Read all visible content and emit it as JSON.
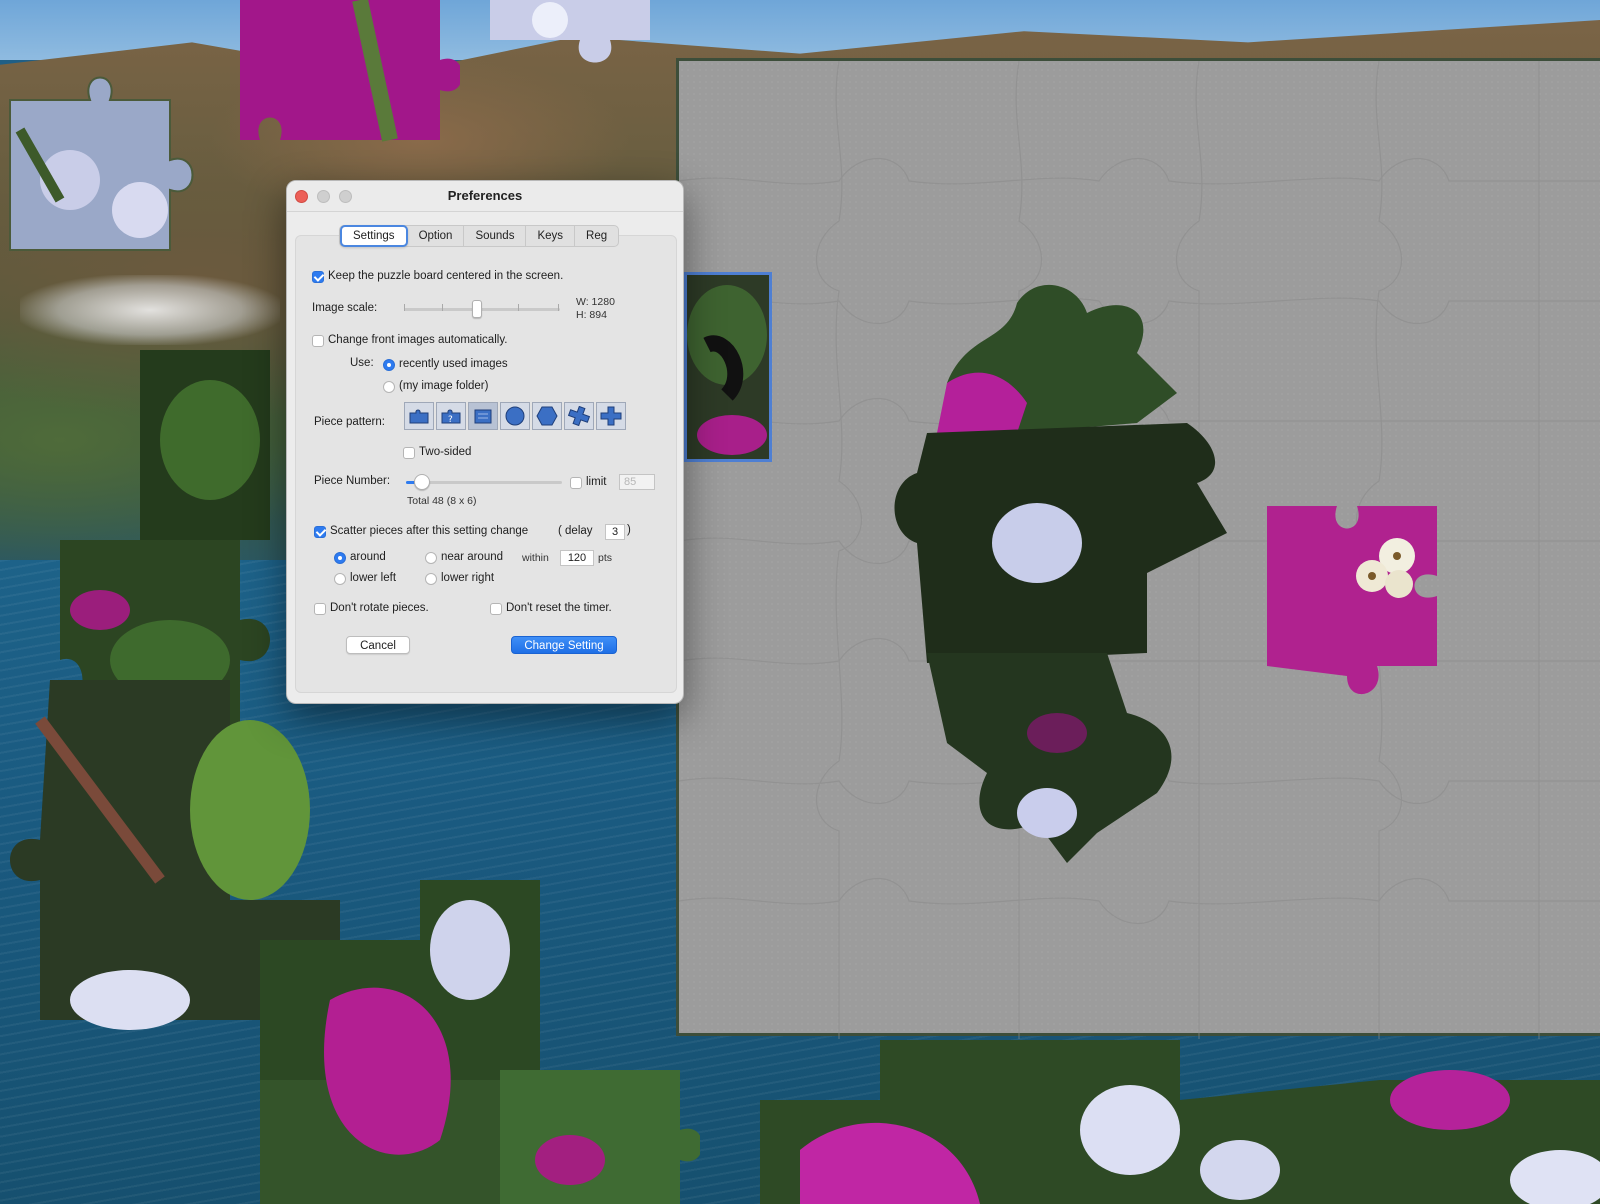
{
  "window": {
    "title": "Preferences"
  },
  "tabs": [
    {
      "label": "Settings",
      "active": true
    },
    {
      "label": "Option",
      "active": false
    },
    {
      "label": "Sounds",
      "active": false
    },
    {
      "label": "Keys",
      "active": false
    },
    {
      "label": "Reg",
      "active": false
    }
  ],
  "settings": {
    "keep_centered": {
      "label": "Keep the puzzle board centered in the screen.",
      "checked": true
    },
    "image_scale": {
      "label": "Image scale:",
      "width": "W: 1280",
      "height": "H: 894"
    },
    "change_front": {
      "label": "Change front images automatically.",
      "checked": false
    },
    "use": {
      "label": "Use:",
      "options": [
        {
          "label": "recently used images",
          "selected": true
        },
        {
          "label": "(my image folder)",
          "selected": false
        }
      ]
    },
    "piece_pattern": {
      "label": "Piece pattern:",
      "icons": [
        "classic-piece-icon",
        "question-piece-icon",
        "square-piece-icon",
        "circle-piece-icon",
        "hexagon-piece-icon",
        "cross-piece-icon",
        "plus-piece-icon"
      ],
      "selected_index": 2
    },
    "two_sided": {
      "label": "Two-sided",
      "checked": false
    },
    "piece_number": {
      "label": "Piece Number:",
      "limit_label": "limit",
      "limit_checked": false,
      "limit_value": "85",
      "total": "Total 48 (8 x 6)"
    },
    "scatter": {
      "label": "Scatter pieces after this setting change",
      "checked": true,
      "delay_label": "( delay",
      "delay_value": "3",
      "delay_close": ")",
      "positions": [
        {
          "label": "around",
          "selected": true
        },
        {
          "label": "near around",
          "selected": false
        },
        {
          "label": "lower left",
          "selected": false
        },
        {
          "label": "lower right",
          "selected": false
        }
      ],
      "within_label": "within",
      "within_value": "120",
      "pts_label": "pts"
    },
    "dont_rotate": {
      "label": "Don't rotate pieces.",
      "checked": false
    },
    "dont_reset": {
      "label": "Don't reset the timer.",
      "checked": false
    }
  },
  "buttons": {
    "cancel": "Cancel",
    "change": "Change Setting"
  },
  "colors": {
    "accent": "#2e7bf0",
    "board": "#9c9c9c",
    "magenta_flower": "#b0228f",
    "leaf": "#2f4a25"
  }
}
